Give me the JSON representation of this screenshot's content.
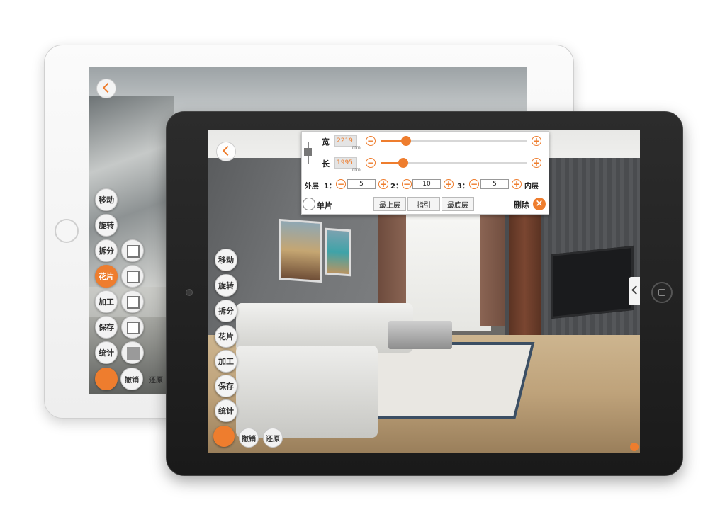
{
  "back_tablet": {
    "toolbar": [
      {
        "label": "移动"
      },
      {
        "label": "旋转"
      },
      {
        "label": "拆分"
      },
      {
        "label": "花片",
        "active": true
      },
      {
        "label": "加工"
      },
      {
        "label": "保存"
      },
      {
        "label": "统计"
      }
    ],
    "undo_label": "撤销",
    "restore_label": "还原"
  },
  "front_tablet": {
    "toolbar": [
      {
        "label": "移动"
      },
      {
        "label": "旋转"
      },
      {
        "label": "拆分"
      },
      {
        "label": "花片"
      },
      {
        "label": "加工"
      },
      {
        "label": "保存"
      },
      {
        "label": "统计"
      }
    ],
    "undo_label": "撤销",
    "restore_label": "还原",
    "panel": {
      "width_label": "宽",
      "width_value": "2219",
      "width_unit": "mm",
      "width_slider": 0.17,
      "length_label": "长",
      "length_value": "1995",
      "length_unit": "mm",
      "length_slider": 0.15,
      "outer_layer_label": "外层",
      "inner_layer_label": "内层",
      "layers": [
        {
          "label": "1：",
          "value": "5"
        },
        {
          "label": "2：",
          "value": "10"
        },
        {
          "label": "3：",
          "value": "5"
        }
      ],
      "single_label": "单片",
      "top_layer_label": "最上层",
      "guide_label": "指引",
      "bottom_layer_label": "最底层",
      "delete_label": "删除"
    }
  },
  "colors": {
    "accent": "#ee7d2e",
    "button_bg": "#f4f4f4"
  }
}
